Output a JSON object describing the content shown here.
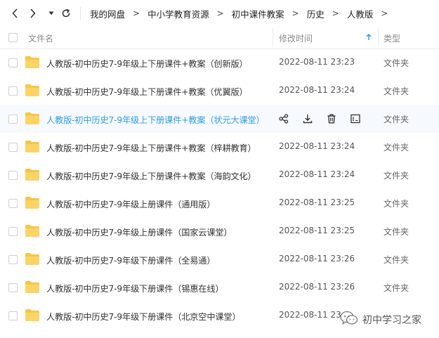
{
  "toolbar": {
    "back_icon": "chevron-left-icon",
    "forward_icon": "chevron-right-icon",
    "history_icon": "caret-down-icon",
    "refresh_icon": "refresh-icon"
  },
  "breadcrumb": [
    "我的网盘",
    "中小学教育资源",
    "初中课件教案",
    "历史",
    "人教版"
  ],
  "breadcrumb_separator": ">",
  "columns": {
    "name": "文件名",
    "modified": "修改时间",
    "type": "类型",
    "sort_icon": "arrow-up-icon"
  },
  "colors": {
    "accent": "#2e9fe0",
    "folder": "#f7c644",
    "hover_row": "#f6f9fd"
  },
  "files": [
    {
      "name": "人教版-初中历史7-9年级上下册课件+教案（创新版）",
      "modified": "2022-08-11 23:23",
      "type": "文件夹"
    },
    {
      "name": "人教版-初中历史7-9年级上下册课件+教案（优翼版）",
      "modified": "2022-08-11 23:24",
      "type": "文件夹"
    },
    {
      "name": "人教版-初中历史7-9年级上下册课件+教案（状元大课堂）",
      "modified": "",
      "type": "文件夹",
      "hovered": true
    },
    {
      "name": "人教版-初中历史7-9年级上下册课件+教案（梓耕教育）",
      "modified": "2022-08-11 23:24",
      "type": "文件夹"
    },
    {
      "name": "人教版-初中历史7-9年级上下册课件+教案（海韵文化）",
      "modified": "2022-08-11 23:24",
      "type": "文件夹"
    },
    {
      "name": "人教版-初中历史7-9年级上册课件（通用版）",
      "modified": "2022-08-11 23:25",
      "type": "文件夹"
    },
    {
      "name": "人教版-初中历史7-9年级上册课件（国家云课堂）",
      "modified": "2022-08-11 23:25",
      "type": "文件夹"
    },
    {
      "name": "人教版-初中历史7-9年级下册课件（全易通）",
      "modified": "2022-08-11 23:26",
      "type": "文件夹"
    },
    {
      "name": "人教版-初中历史7-9年级下册课件（锡惠在线）",
      "modified": "2022-08-11 23:26",
      "type": "文件夹"
    },
    {
      "name": "人教版-初中历史7-9年级下册课件（北京空中课堂）",
      "modified": "2022-08-11 23:",
      "type": "文件夹"
    }
  ],
  "row_actions": [
    "share-icon",
    "download-icon",
    "delete-icon",
    "rename-icon"
  ],
  "watermark": {
    "text": "初中学习之家",
    "icon": "wechat-icon"
  }
}
